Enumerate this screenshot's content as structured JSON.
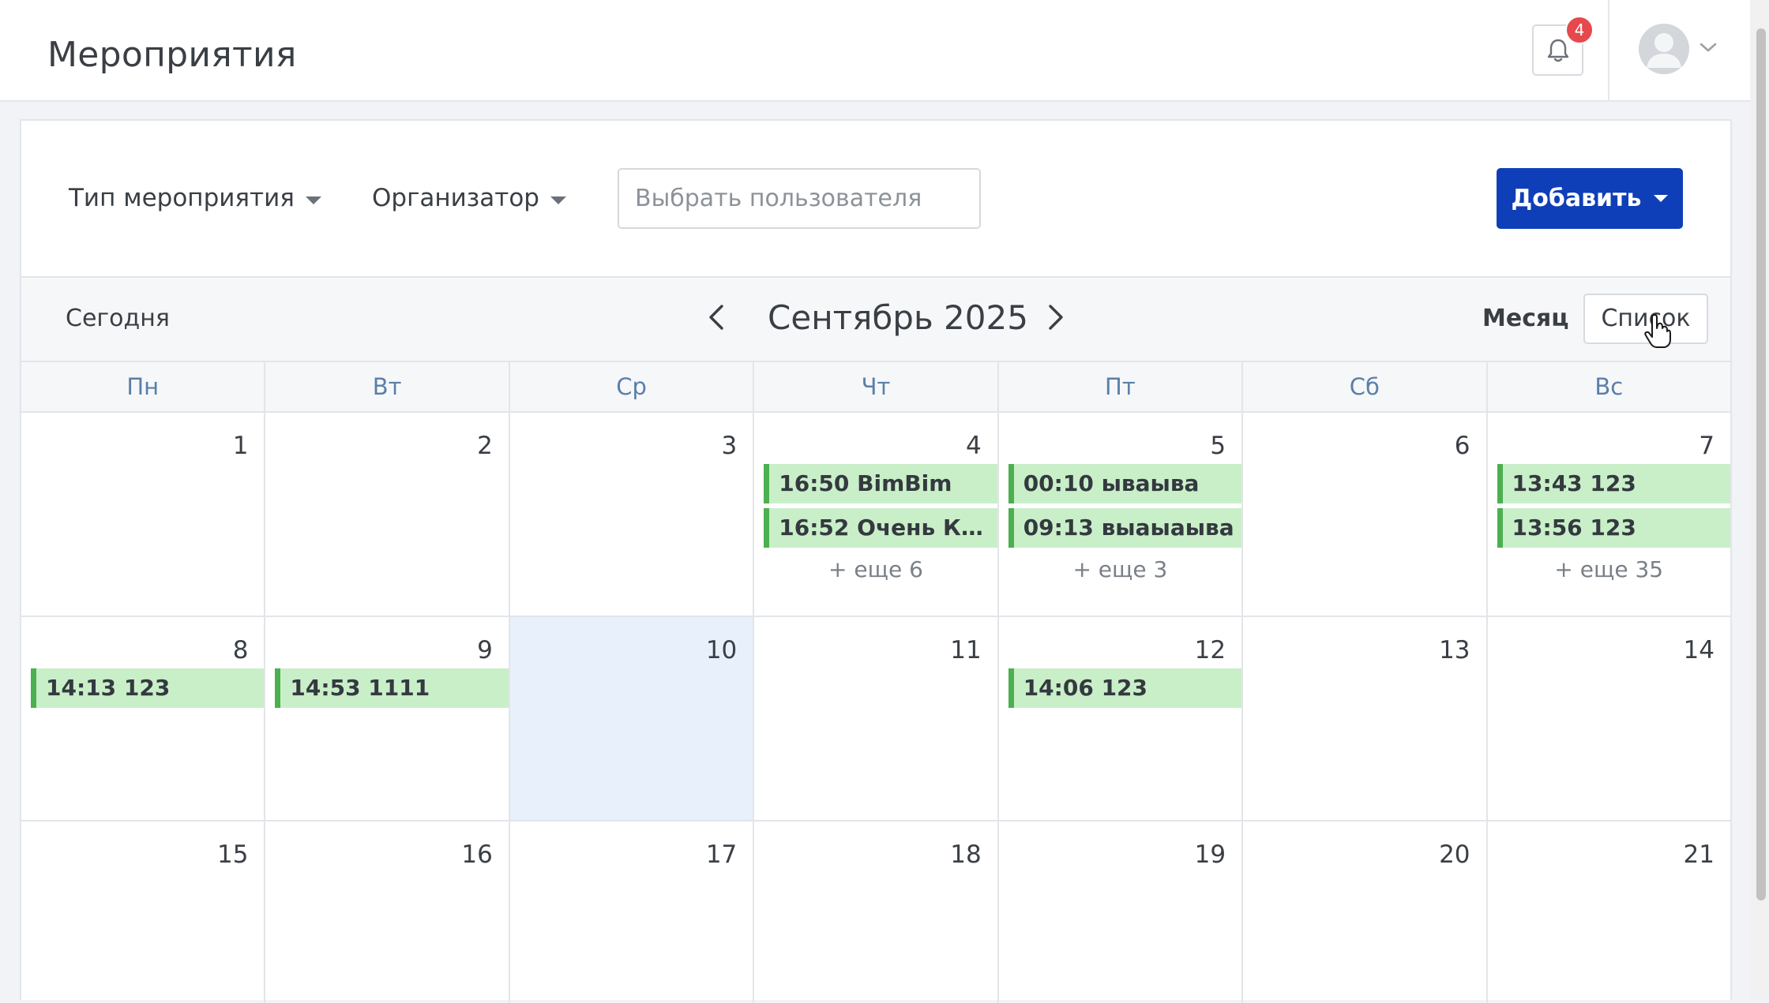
{
  "header": {
    "title": "Мероприятия",
    "notifications_count": "4"
  },
  "filters": {
    "event_type_label": "Тип мероприятия",
    "organizer_label": "Организатор",
    "user_placeholder": "Выбрать пользователя",
    "add_label": "Добавить"
  },
  "calendar": {
    "today_label": "Сегодня",
    "month_title": "Сентябрь 2025",
    "view_month_label": "Месяц",
    "view_list_label": "Список",
    "weekdays": [
      "Пн",
      "Вт",
      "Ср",
      "Чт",
      "Пт",
      "Сб",
      "Вс"
    ],
    "weeks": [
      {
        "days": [
          {
            "num": "1"
          },
          {
            "num": "2"
          },
          {
            "num": "3"
          },
          {
            "num": "4",
            "events": [
              "16:50 BimBim",
              "16:52 Очень Кор..."
            ],
            "more": "+ еще 6"
          },
          {
            "num": "5",
            "events": [
              "00:10 ываыва",
              "09:13 выаыаыва"
            ],
            "more": "+ еще 3"
          },
          {
            "num": "6"
          },
          {
            "num": "7",
            "events": [
              "13:43 123",
              "13:56 123"
            ],
            "more": "+ еще 35"
          }
        ]
      },
      {
        "days": [
          {
            "num": "8",
            "events": [
              "14:13 123"
            ]
          },
          {
            "num": "9",
            "events": [
              "14:53 1111"
            ]
          },
          {
            "num": "10",
            "today": true
          },
          {
            "num": "11"
          },
          {
            "num": "12",
            "events": [
              "14:06 123"
            ]
          },
          {
            "num": "13"
          },
          {
            "num": "14"
          }
        ]
      },
      {
        "days": [
          {
            "num": "15"
          },
          {
            "num": "16"
          },
          {
            "num": "17"
          },
          {
            "num": "18"
          },
          {
            "num": "19"
          },
          {
            "num": "20"
          },
          {
            "num": "21"
          }
        ]
      }
    ]
  },
  "colors": {
    "primary": "#0f3fb8",
    "event_bg": "#c9efc9",
    "event_border": "#4caf50",
    "today_bg": "#e8f0fb",
    "badge": "#e5484d"
  },
  "icons": {
    "notifications": "bell-icon",
    "avatar": "user-avatar-icon",
    "prev": "chevron-left-icon",
    "next": "chevron-right-icon"
  }
}
